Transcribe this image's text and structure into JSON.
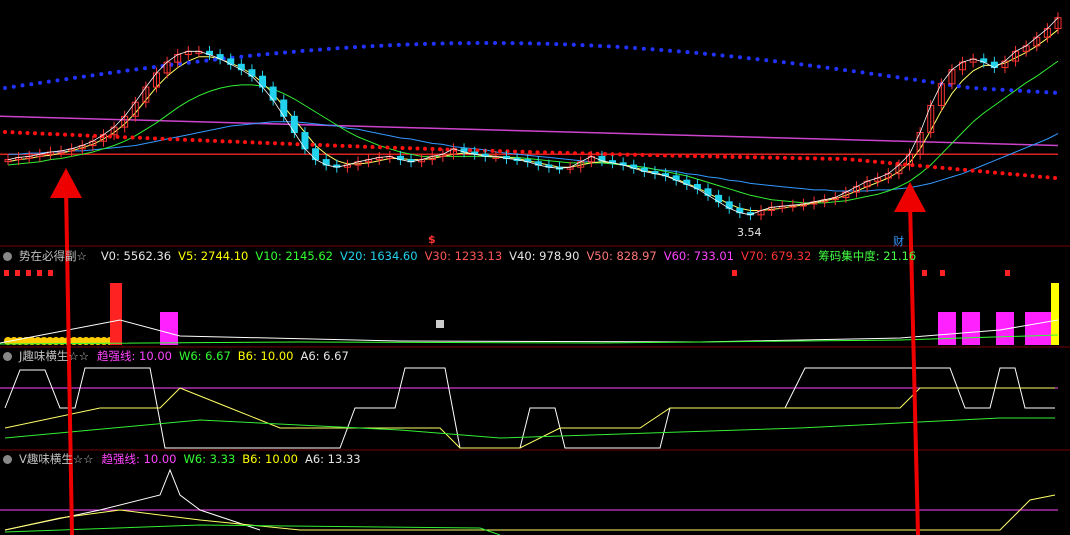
{
  "colors": {
    "up": "#ff3333",
    "down": "#22d3ee",
    "ma5": "#ffffff",
    "ma10": "#ffff66",
    "ma20": "#33ee33",
    "ma60": "#3399ff",
    "ma120": "#ff44ff",
    "blue_dots": "#2233ff",
    "red_dots": "#ff1111",
    "arrow": "#ee0000"
  },
  "main": {
    "low_label": "3.54",
    "buy_marker": "$",
    "finance_marker": "财"
  },
  "indicator1": {
    "title": "势在必得副☆",
    "v0": "V0: 5562.36",
    "v5": "V5: 2744.10",
    "v10": "V10: 2145.62",
    "v20": "V20: 1634.60",
    "v30": "V30: 1233.13",
    "v40": "V40: 978.90",
    "v50": "V50: 828.97",
    "v60": "V60: 733.01",
    "v70": "V70: 679.32",
    "concentration": "筹码集中度: 21.16"
  },
  "indicator2": {
    "title": "J趣味横生☆☆",
    "trend_line": "趋强线: 10.00",
    "w6": "W6: 6.67",
    "b6": "B6: 10.00",
    "a6": "A6: 6.67"
  },
  "indicator3": {
    "title": "V趣味横生☆☆",
    "trend_line": "趋强线: 10.00",
    "w6": "W6: 3.33",
    "b6": "B6: 10.00",
    "a6": "A6: 13.33"
  },
  "chart_data": {
    "type": "candlestick",
    "note_price_series": "closing-price path (relative, min ≈ 3.54)",
    "close": [
      4.05,
      4.07,
      4.08,
      4.1,
      4.12,
      4.13,
      4.15,
      4.18,
      4.22,
      4.28,
      4.35,
      4.45,
      4.58,
      4.72,
      4.85,
      4.95,
      5.02,
      5.05,
      5.05,
      5.02,
      4.98,
      4.93,
      4.88,
      4.82,
      4.72,
      4.6,
      4.45,
      4.3,
      4.15,
      4.05,
      4.0,
      3.98,
      4.0,
      4.03,
      4.05,
      4.07,
      4.08,
      4.05,
      4.03,
      4.05,
      4.08,
      4.1,
      4.15,
      4.12,
      4.1,
      4.08,
      4.08,
      4.06,
      4.05,
      4.03,
      4.0,
      3.98,
      3.97,
      3.98,
      4.03,
      4.08,
      4.04,
      4.02,
      4.0,
      3.97,
      3.94,
      3.92,
      3.9,
      3.86,
      3.82,
      3.78,
      3.72,
      3.66,
      3.6,
      3.56,
      3.54,
      3.58,
      3.61,
      3.62,
      3.63,
      3.64,
      3.66,
      3.68,
      3.7,
      3.75,
      3.8,
      3.85,
      3.88,
      3.92,
      4.0,
      4.1,
      4.3,
      4.55,
      4.75,
      4.88,
      4.95,
      4.98,
      4.95,
      4.9,
      4.96,
      5.05,
      5.1,
      5.18,
      5.26,
      5.36
    ],
    "ma_fast": [
      4.03,
      4.05,
      4.06,
      4.08,
      4.09,
      4.11,
      4.13,
      4.16,
      4.19,
      4.24,
      4.3,
      4.38,
      4.48,
      4.6,
      4.72,
      4.82,
      4.9,
      4.96,
      5.0,
      5.0,
      4.98,
      4.94,
      4.9,
      4.84,
      4.76,
      4.66,
      4.54,
      4.42,
      4.3,
      4.18,
      4.1,
      4.04,
      4.01,
      4.01,
      4.02,
      4.04,
      4.06,
      4.06,
      4.05,
      4.05,
      4.06,
      4.08,
      4.1,
      4.11,
      4.1,
      4.09,
      4.08,
      4.07,
      4.06,
      4.04,
      4.02,
      4.0,
      3.98,
      3.98,
      4.0,
      4.02,
      4.03,
      4.02,
      4.0,
      3.98,
      3.95,
      3.93,
      3.9,
      3.87,
      3.83,
      3.79,
      3.74,
      3.69,
      3.64,
      3.6,
      3.58,
      3.58,
      3.59,
      3.6,
      3.62,
      3.63,
      3.65,
      3.67,
      3.69,
      3.72,
      3.76,
      3.8,
      3.84,
      3.88,
      3.94,
      4.02,
      4.15,
      4.32,
      4.5,
      4.66,
      4.78,
      4.87,
      4.92,
      4.92,
      4.94,
      4.99,
      5.04,
      5.1,
      5.17,
      5.25
    ],
    "ma_mid": [
      4.0,
      4.01,
      4.02,
      4.03,
      4.05,
      4.06,
      4.08,
      4.1,
      4.12,
      4.15,
      4.18,
      4.22,
      4.27,
      4.33,
      4.39,
      4.46,
      4.53,
      4.59,
      4.64,
      4.68,
      4.71,
      4.73,
      4.74,
      4.74,
      4.73,
      4.7,
      4.66,
      4.61,
      4.55,
      4.49,
      4.43,
      4.37,
      4.31,
      4.26,
      4.22,
      4.18,
      4.15,
      4.12,
      4.1,
      4.08,
      4.08,
      4.08,
      4.08,
      4.08,
      4.08,
      4.08,
      4.07,
      4.07,
      4.07,
      4.06,
      4.05,
      4.04,
      4.03,
      4.02,
      4.02,
      4.02,
      4.02,
      4.01,
      4.0,
      3.99,
      3.98,
      3.96,
      3.94,
      3.92,
      3.9,
      3.87,
      3.84,
      3.81,
      3.78,
      3.75,
      3.72,
      3.7,
      3.68,
      3.67,
      3.66,
      3.65,
      3.65,
      3.65,
      3.66,
      3.67,
      3.69,
      3.71,
      3.73,
      3.76,
      3.8,
      3.85,
      3.92,
      4.0,
      4.1,
      4.2,
      4.3,
      4.4,
      4.48,
      4.55,
      4.62,
      4.69,
      4.76,
      4.82,
      4.89,
      4.96
    ],
    "ma_slow": [
      4.1,
      4.1,
      4.11,
      4.11,
      4.12,
      4.12,
      4.13,
      4.13,
      4.14,
      4.15,
      4.16,
      4.17,
      4.18,
      4.2,
      4.22,
      4.24,
      4.26,
      4.28,
      4.3,
      4.32,
      4.34,
      4.36,
      4.37,
      4.38,
      4.39,
      4.4,
      4.4,
      4.4,
      4.39,
      4.38,
      4.37,
      4.36,
      4.34,
      4.33,
      4.31,
      4.29,
      4.27,
      4.25,
      4.24,
      4.22,
      4.2,
      4.19,
      4.17,
      4.16,
      4.15,
      4.14,
      4.12,
      4.11,
      4.1,
      4.09,
      4.08,
      4.07,
      4.06,
      4.05,
      4.04,
      4.03,
      4.02,
      4.01,
      4.0,
      3.99,
      3.98,
      3.96,
      3.95,
      3.94,
      3.92,
      3.91,
      3.89,
      3.88,
      3.86,
      3.85,
      3.83,
      3.82,
      3.81,
      3.8,
      3.79,
      3.78,
      3.77,
      3.77,
      3.76,
      3.76,
      3.76,
      3.76,
      3.77,
      3.77,
      3.78,
      3.79,
      3.81,
      3.83,
      3.86,
      3.89,
      3.92,
      3.96,
      4.0,
      4.04,
      4.08,
      4.12,
      4.16,
      4.2,
      4.24,
      4.29
    ]
  }
}
